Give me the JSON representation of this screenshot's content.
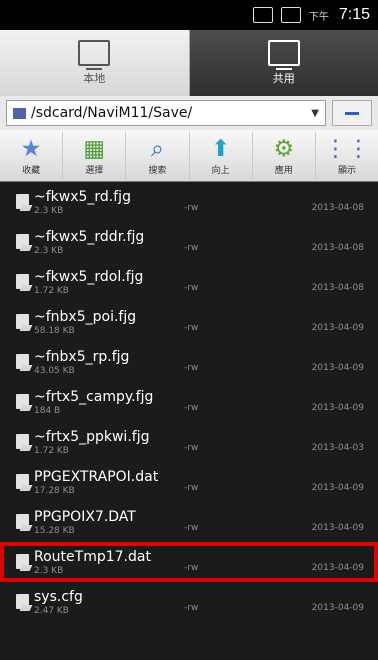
{
  "status": {
    "time": "7:15",
    "ampm": "下午"
  },
  "tabs": [
    {
      "label": "本地",
      "icon": "tablet-icon"
    },
    {
      "label": "共用",
      "icon": "monitor-icon"
    }
  ],
  "path": {
    "current": "/sdcard/NaviM11/Save/"
  },
  "toolbar": [
    {
      "label": "收藏",
      "icon": "star-icon"
    },
    {
      "label": "選擇",
      "icon": "grid-icon"
    },
    {
      "label": "搜索",
      "icon": "search-icon"
    },
    {
      "label": "向上",
      "icon": "up-icon"
    },
    {
      "label": "應用",
      "icon": "gear-icon"
    },
    {
      "label": "顯示",
      "icon": "view-icon"
    }
  ],
  "files": [
    {
      "name": "~fkwx5_rd.fjg",
      "size": "2.3 KB",
      "perm": "-rw",
      "date": "2013-04-08"
    },
    {
      "name": "~fkwx5_rddr.fjg",
      "size": "2.3 KB",
      "perm": "-rw",
      "date": "2013-04-08"
    },
    {
      "name": "~fkwx5_rdol.fjg",
      "size": "1.72 KB",
      "perm": "-rw",
      "date": "2013-04-08"
    },
    {
      "name": "~fnbx5_poi.fjg",
      "size": "58.18 KB",
      "perm": "-rw",
      "date": "2013-04-09"
    },
    {
      "name": "~fnbx5_rp.fjg",
      "size": "43.05 KB",
      "perm": "-rw",
      "date": "2013-04-09"
    },
    {
      "name": "~frtx5_campy.fjg",
      "size": "184 B",
      "perm": "-rw",
      "date": "2013-04-09"
    },
    {
      "name": "~frtx5_ppkwi.fjg",
      "size": "1.72 KB",
      "perm": "-rw",
      "date": "2013-04-03"
    },
    {
      "name": "PPGEXTRAPOI.dat",
      "size": "17.28 KB",
      "perm": "-rw",
      "date": "2013-04-09"
    },
    {
      "name": "PPGPOIX7.DAT",
      "size": "15.28 KB",
      "perm": "-rw",
      "date": "2013-04-09"
    },
    {
      "name": "RouteTmp17.dat",
      "size": "2.3 KB",
      "perm": "-rw",
      "date": "2013-04-09",
      "selected": true
    },
    {
      "name": "sys.cfg",
      "size": "2.47 KB",
      "perm": "-rw",
      "date": "2013-04-09"
    }
  ]
}
